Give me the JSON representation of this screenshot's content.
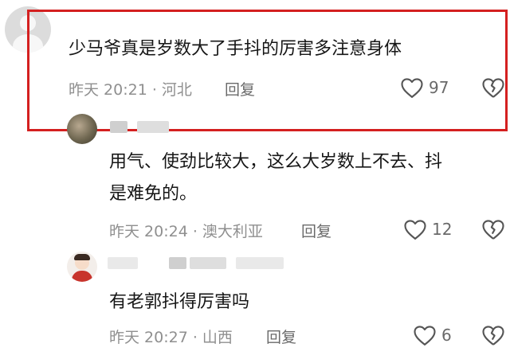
{
  "comments": [
    {
      "text": "少马爷真是岁数大了手抖的厉害多注意身体",
      "time_location": "昨天 20:21 · 河北",
      "reply_label": "回复",
      "like_count": "97"
    },
    {
      "text_line1": "用气、使劲比较大，这么大岁数上不去、抖",
      "text_line2": "是难免的。",
      "time_location": "昨天 20:24 · 澳大利亚",
      "reply_label": "回复",
      "like_count": "12"
    },
    {
      "text": "有老郭抖得厉害吗",
      "time_location": "昨天 20:27 · 山西",
      "reply_label": "回复",
      "like_count": "6"
    }
  ],
  "icons": {
    "like": "heart-outline-icon",
    "dislike": "broken-heart-outline-icon"
  },
  "colors": {
    "highlight_border": "#d42020",
    "meta_text": "#8f8f8f",
    "icon_stroke": "#555555"
  }
}
